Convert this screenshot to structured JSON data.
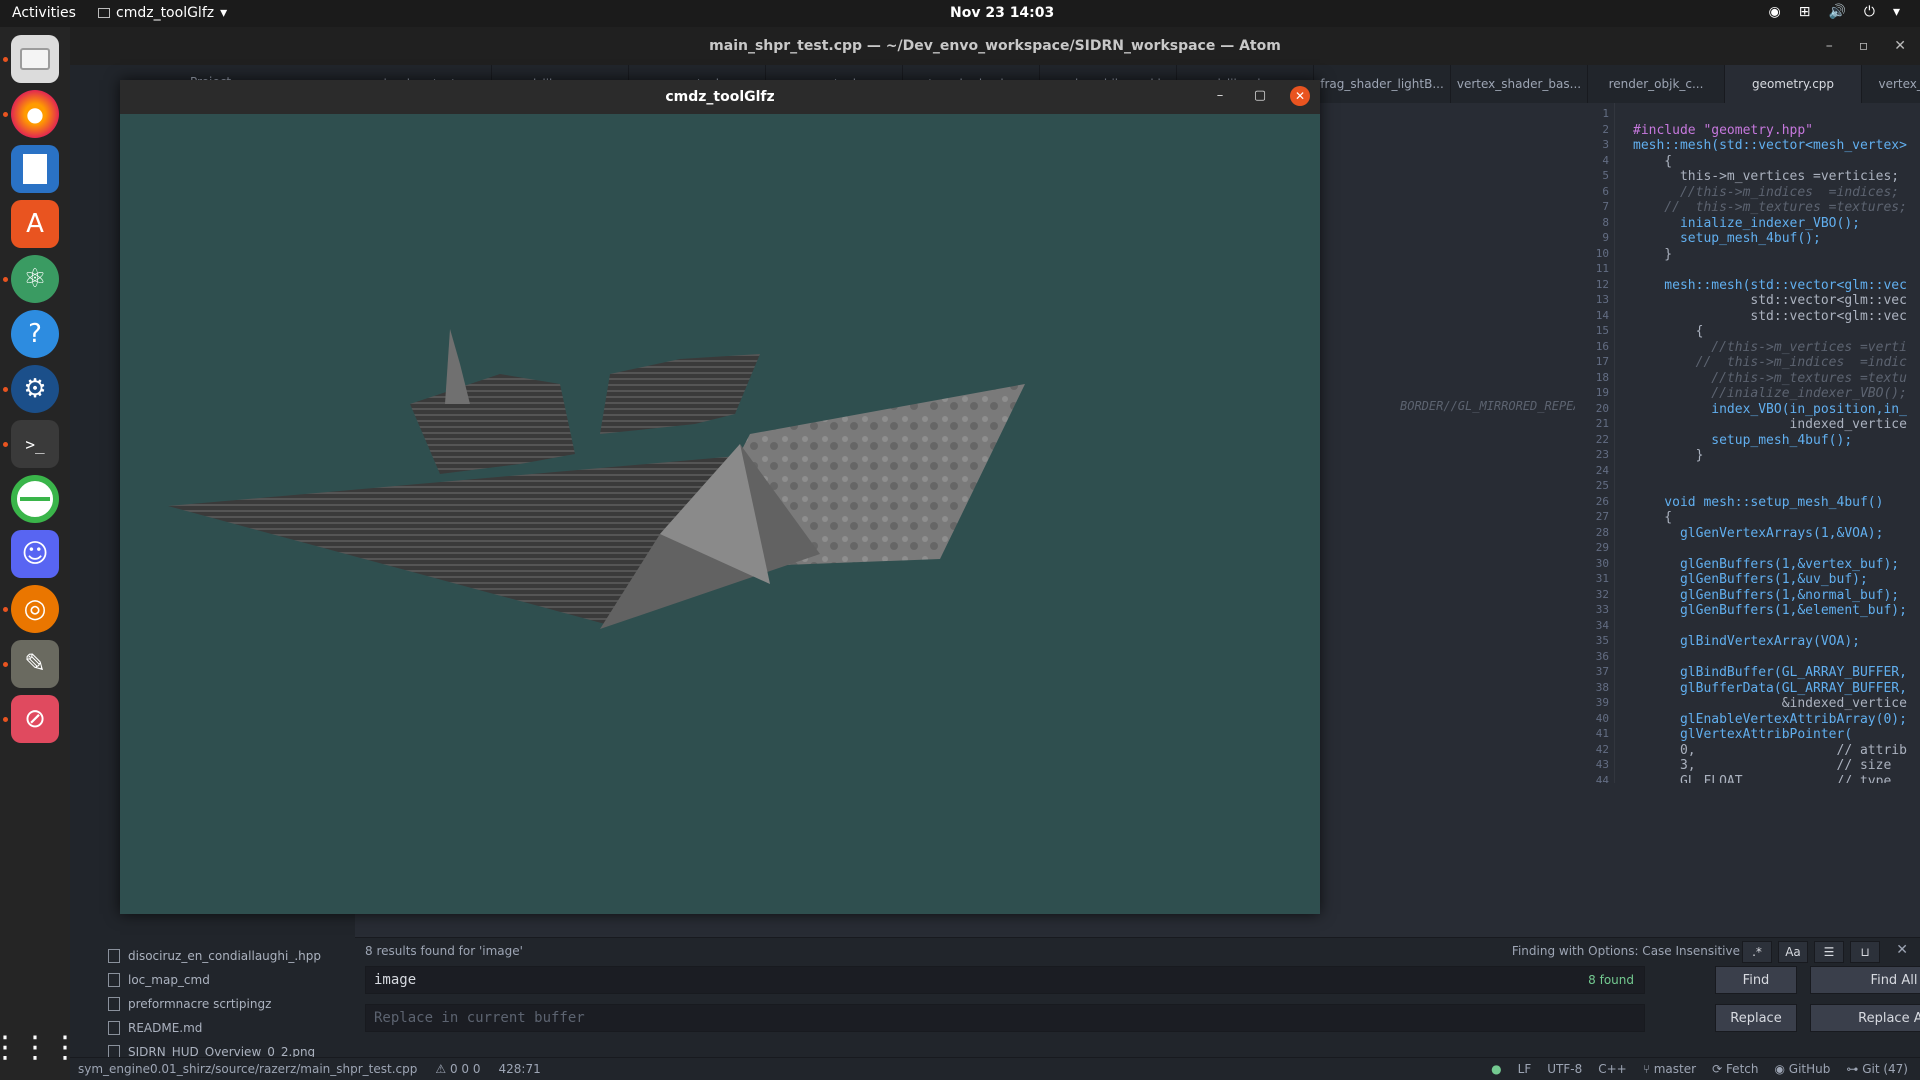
{
  "topbar": {
    "activities": "Activities",
    "app_name": "cmdz_toolGlfz",
    "clock": "Nov 23  14:03"
  },
  "dock": {
    "icons": [
      "files-icon",
      "firefox-icon",
      "writer-icon",
      "software-icon",
      "atom-icon",
      "help-icon",
      "steam-icon",
      "terminal-icon",
      "gnome-icon",
      "discord-icon",
      "blender-icon",
      "gimp-icon",
      "blocked-app-icon",
      "app-grid-icon"
    ]
  },
  "atom": {
    "title": "main_shpr_test.cpp — ~/Dev_envo_workspace/SIDRN_workspace — Atom",
    "project_label": "Project",
    "tabs": [
      {
        "label": "main_shpr_test.cpp",
        "active": false
      },
      {
        "label": "gl_lib_z.cpp",
        "active": false
      },
      {
        "label": "geometry.hpp",
        "active": false
      },
      {
        "label": "geometry.hpp",
        "active": false
      },
      {
        "label": "vertex_shader_bas...",
        "active": false
      },
      {
        "label": "render_objk_cmd.h",
        "active": false
      },
      {
        "label": "gl_lib_z.hpp",
        "active": false
      },
      {
        "label": "frag_shader_lightB...",
        "active": false
      },
      {
        "label": "vertex_shader_bas...",
        "active": false
      },
      {
        "label": "render_objk_c...",
        "active": false
      },
      {
        "label": "geometry.cpp",
        "active": true
      },
      {
        "label": "vertex_shader_...",
        "active": false
      }
    ],
    "tree_items": [
      {
        "label": "disociruz_en_condiallaughi_.hpp"
      },
      {
        "label": "loc_map_cmd"
      },
      {
        "label": "preformnacre scrtipingz"
      },
      {
        "label": "README.md"
      },
      {
        "label": "SIDRN_HUD_Overview_0_2.png"
      }
    ],
    "ghost_text": "BORDER//GL_MIRRORED_REPEAT",
    "code_lines": [
      {
        "n": "1",
        "t": ""
      },
      {
        "n": "2",
        "t": "#include \"geometry.hpp\""
      },
      {
        "n": "3",
        "t": "mesh::mesh(std::vector<mesh_vertex>"
      },
      {
        "n": "4",
        "t": "    {"
      },
      {
        "n": "5",
        "t": "      this->m_vertices =verticies;"
      },
      {
        "n": "6",
        "t": "      //this->m_indices  =indices;"
      },
      {
        "n": "7",
        "t": "    //  this->m_textures =textures;"
      },
      {
        "n": "8",
        "t": "      inialize_indexer_VBO();"
      },
      {
        "n": "9",
        "t": "      setup_mesh_4buf();"
      },
      {
        "n": "10",
        "t": "    }"
      },
      {
        "n": "11",
        "t": ""
      },
      {
        "n": "12",
        "t": "    mesh::mesh(std::vector<glm::vec"
      },
      {
        "n": "13",
        "t": "               std::vector<glm::vec"
      },
      {
        "n": "14",
        "t": "               std::vector<glm::vec"
      },
      {
        "n": "15",
        "t": "        {"
      },
      {
        "n": "16",
        "t": "          //this->m_vertices =verti"
      },
      {
        "n": "17",
        "t": "        //  this->m_indices  =indic"
      },
      {
        "n": "18",
        "t": "          //this->m_textures =textu"
      },
      {
        "n": "19",
        "t": "          //inialize_indexer_VBO();"
      },
      {
        "n": "20",
        "t": "          index_VBO(in_position,in_"
      },
      {
        "n": "21",
        "t": "                    indexed_vertice"
      },
      {
        "n": "22",
        "t": "          setup_mesh_4buf();"
      },
      {
        "n": "23",
        "t": "        }"
      },
      {
        "n": "24",
        "t": ""
      },
      {
        "n": "25",
        "t": ""
      },
      {
        "n": "26",
        "t": "    void mesh::setup_mesh_4buf()"
      },
      {
        "n": "27",
        "t": "    {"
      },
      {
        "n": "28",
        "t": "      glGenVertexArrays(1,&VOA);"
      },
      {
        "n": "29",
        "t": ""
      },
      {
        "n": "30",
        "t": "      glGenBuffers(1,&vertex_buf);"
      },
      {
        "n": "31",
        "t": "      glGenBuffers(1,&uv_buf);"
      },
      {
        "n": "32",
        "t": "      glGenBuffers(1,&normal_buf);"
      },
      {
        "n": "33",
        "t": "      glGenBuffers(1,&element_buf);"
      },
      {
        "n": "34",
        "t": ""
      },
      {
        "n": "35",
        "t": "      glBindVertexArray(VOA);"
      },
      {
        "n": "36",
        "t": ""
      },
      {
        "n": "37",
        "t": "      glBindBuffer(GL_ARRAY_BUFFER,"
      },
      {
        "n": "38",
        "t": "      glBufferData(GL_ARRAY_BUFFER,"
      },
      {
        "n": "39",
        "t": "                   &indexed_vertice"
      },
      {
        "n": "40",
        "t": "      glEnableVertexAttribArray(0);"
      },
      {
        "n": "41",
        "t": "      glVertexAttribPointer("
      },
      {
        "n": "42",
        "t": "      0,                  // attrib"
      },
      {
        "n": "43",
        "t": "      3,                  // size"
      },
      {
        "n": "44",
        "t": "      GL_FLOAT,           // type"
      }
    ],
    "find": {
      "result_text": "8 results found for 'image'",
      "options_text": "Finding with Options: Case Insensitive",
      "query": "image",
      "count": "8 found",
      "replace_placeholder": "Replace in current buffer",
      "find_label": "Find",
      "find_all_label": "Find All",
      "replace_label": "Replace",
      "replace_all_label": "Replace All",
      "opt_regex": ".*",
      "opt_case": "Aa"
    },
    "status": {
      "path": "sym_engine0.01_shirz/source/razerz/main_shpr_test.cpp",
      "diagnostics": "0  0  0",
      "cursor": "428:71",
      "line_ending": "LF",
      "encoding": "UTF-8",
      "grammar": "C++",
      "branch": "master",
      "fetch": "Fetch",
      "github": "GitHub",
      "git": "Git (47)"
    }
  },
  "glwindow": {
    "title": "cmdz_toolGlfz",
    "clear_color": "#2f4f4f"
  }
}
